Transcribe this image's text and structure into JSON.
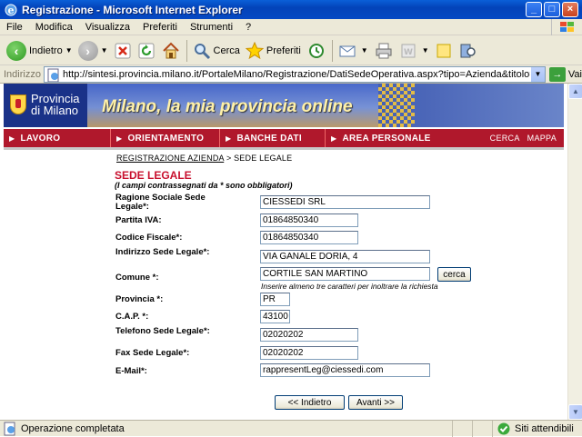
{
  "window": {
    "title": "Registrazione - Microsoft Internet Explorer"
  },
  "menu": [
    "File",
    "Modifica",
    "Visualizza",
    "Preferiti",
    "Strumenti",
    "?"
  ],
  "toolbar": {
    "back": "Indietro",
    "search": "Cerca",
    "favorites": "Preferiti"
  },
  "address": {
    "label": "Indirizzo",
    "url": "http://sintesi.provincia.milano.it/PortaleMilano/Registrazione/DatiSedeOperativa.aspx?tipo=Azienda&titolo=%20Azienda",
    "go": "Vai"
  },
  "banner": {
    "line1": "Provincia",
    "line2": "di Milano",
    "slogan": "Milano, la mia provincia online"
  },
  "nav": {
    "items": [
      "LAVORO",
      "ORIENTAMENTO",
      "BANCHE DATI",
      "AREA PERSONALE"
    ],
    "right": [
      "CERCA",
      "MAPPA"
    ]
  },
  "breadcrumb": {
    "link": "REGISTRAZIONE AZIENDA",
    "sep": ">",
    "current": "SEDE LEGALE"
  },
  "form": {
    "heading": "SEDE LEGALE",
    "note": "(I campi contrassegnati da * sono obbligatori)",
    "fields": {
      "ragione": {
        "label": "Ragione Sociale Sede Legale*:",
        "value": "CIESSEDI SRL"
      },
      "piva": {
        "label": "Partita IVA:",
        "value": "01864850340"
      },
      "cf": {
        "label": "Codice Fiscale*:",
        "value": "01864850340"
      },
      "indirizzo": {
        "label": "Indirizzo Sede Legale*:",
        "value": "VIA GANALE DORIA, 4"
      },
      "comune": {
        "label": "Comune *:",
        "value": "CORTILE SAN MARTINO"
      },
      "provincia": {
        "label": "Provincia *:",
        "value": "PR"
      },
      "cap": {
        "label": "C.A.P. *:",
        "value": "43100"
      },
      "telefono": {
        "label": "Telefono Sede Legale*:",
        "value": "02020202"
      },
      "fax": {
        "label": "Fax Sede Legale*:",
        "value": "02020202"
      },
      "email": {
        "label": "E-Mail*:",
        "value": "rappresentLeg@ciessedi.com"
      }
    },
    "cerca_button": "cerca",
    "hint": "Inserire almeno tre caratteri per inoltrare la richiesta",
    "back_button": "<< Indietro",
    "next_button": "Avanti >>"
  },
  "status": {
    "text": "Operazione completata",
    "zone": "Siti attendibili"
  }
}
